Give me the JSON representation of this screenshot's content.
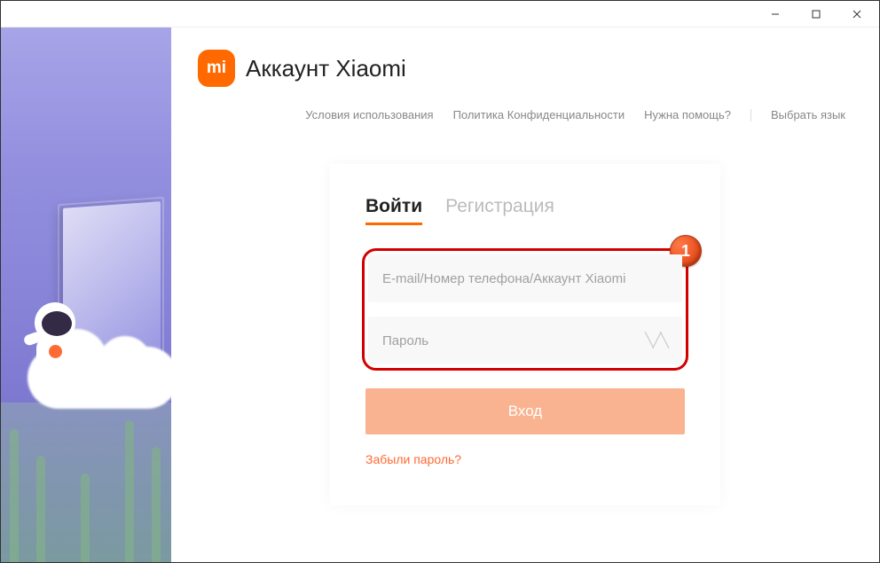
{
  "app": {
    "title": "Аккаунт Xiaomi",
    "logo_text": "mi"
  },
  "titlebar": {
    "minimize": "—",
    "maximize": "☐",
    "close": "✕"
  },
  "nav": {
    "terms": "Условия использования",
    "privacy": "Политика Конфиденциальности",
    "help": "Нужна помощь?",
    "language": "Выбрать язык"
  },
  "tabs": {
    "login": "Войти",
    "register": "Регистрация"
  },
  "form": {
    "login_placeholder": "E-mail/Номер телефона/Аккаунт Xiaomi",
    "password_placeholder": "Пароль",
    "submit": "Вход",
    "forgot": "Забыли пароль?"
  },
  "callout": {
    "number": "1",
    "accent_color": "#d40000"
  },
  "colors": {
    "brand": "#ff6900",
    "link": "#ff6933"
  }
}
